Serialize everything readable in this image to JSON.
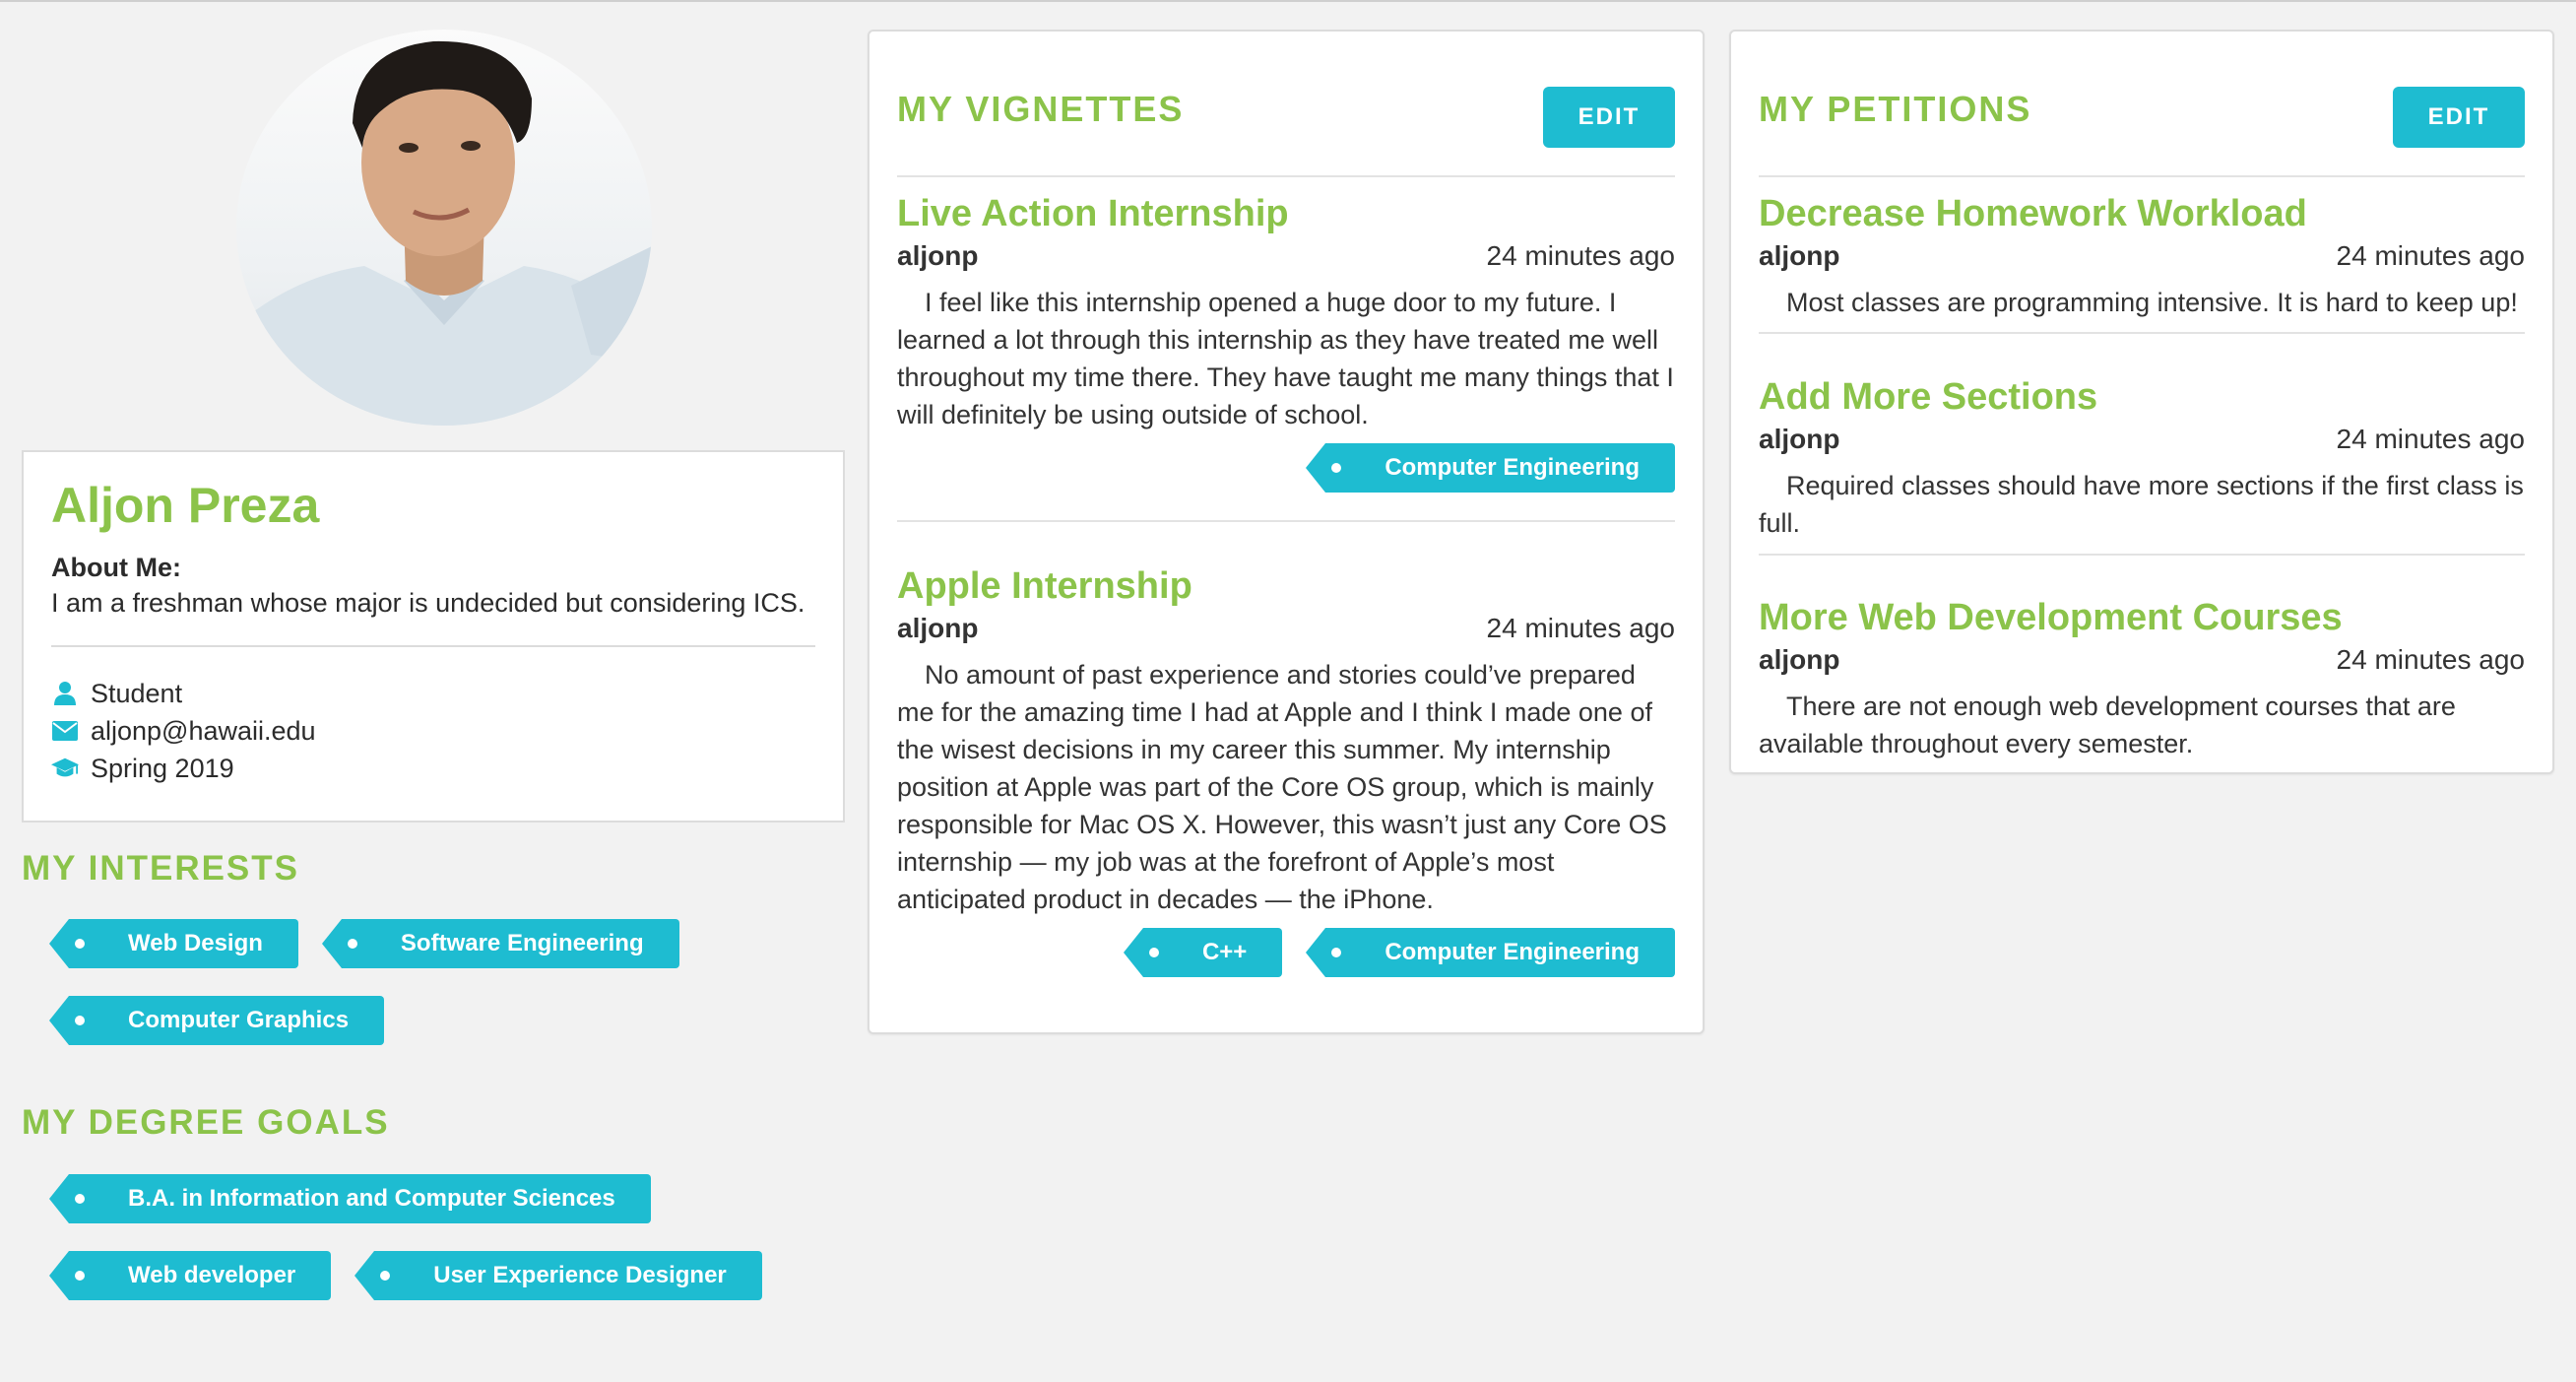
{
  "profile": {
    "name": "Aljon Preza",
    "about_label": "About Me:",
    "about_text": "I am a freshman whose major is undecided but considering ICS.",
    "role": "Student",
    "email": "aljonp@hawaii.edu",
    "term": "Spring 2019",
    "icons": [
      "user-icon",
      "envelope-icon",
      "graduation-cap-icon"
    ]
  },
  "interests": {
    "title": "MY INTERESTS",
    "tags": [
      "Web Design",
      "Software Engineering",
      "Computer Graphics"
    ]
  },
  "degree_goals": {
    "title": "MY DEGREE GOALS",
    "tags": [
      "B.A. in Information and Computer Sciences",
      "Web developer",
      "User Experience Designer"
    ]
  },
  "vignettes": {
    "title": "MY VIGNETTES",
    "edit_label": "EDIT",
    "items": [
      {
        "title": "Live Action Internship",
        "author": "aljonp",
        "time": "24 minutes ago",
        "body": "I feel like this internship opened a huge door to my future. I learned a lot through this internship as they have treated me well throughout my time there. They have taught me many things that I will definitely be using outside of school.",
        "tags": [
          "Computer Engineering"
        ]
      },
      {
        "title": "Apple Internship",
        "author": "aljonp",
        "time": "24 minutes ago",
        "body": "No amount of past experience and stories could’ve prepared me for the amazing time I had at Apple and I think I made one of the wisest decisions in my career this summer. My internship position at Apple was part of the Core OS group, which is mainly responsible for Mac OS X. However, this wasn’t just any Core OS internship — my job was at the forefront of Apple’s most anticipated product in decades — the iPhone.",
        "tags": [
          "C++",
          "Computer Engineering"
        ]
      }
    ]
  },
  "petitions": {
    "title": "MY PETITIONS",
    "edit_label": "EDIT",
    "items": [
      {
        "title": "Decrease Homework Workload",
        "author": "aljonp",
        "time": "24 minutes ago",
        "body": "Most classes are programming intensive. It is hard to keep up!"
      },
      {
        "title": "Add More Sections",
        "author": "aljonp",
        "time": "24 minutes ago",
        "body": "Required classes should have more sections if the first class is full."
      },
      {
        "title": "More Web Development Courses",
        "author": "aljonp",
        "time": "24 minutes ago",
        "body": "There are not enough web development courses that are available throughout every semester."
      }
    ]
  },
  "colors": {
    "accent_green": "#8bc34a",
    "accent_cyan": "#1ebcd1"
  }
}
